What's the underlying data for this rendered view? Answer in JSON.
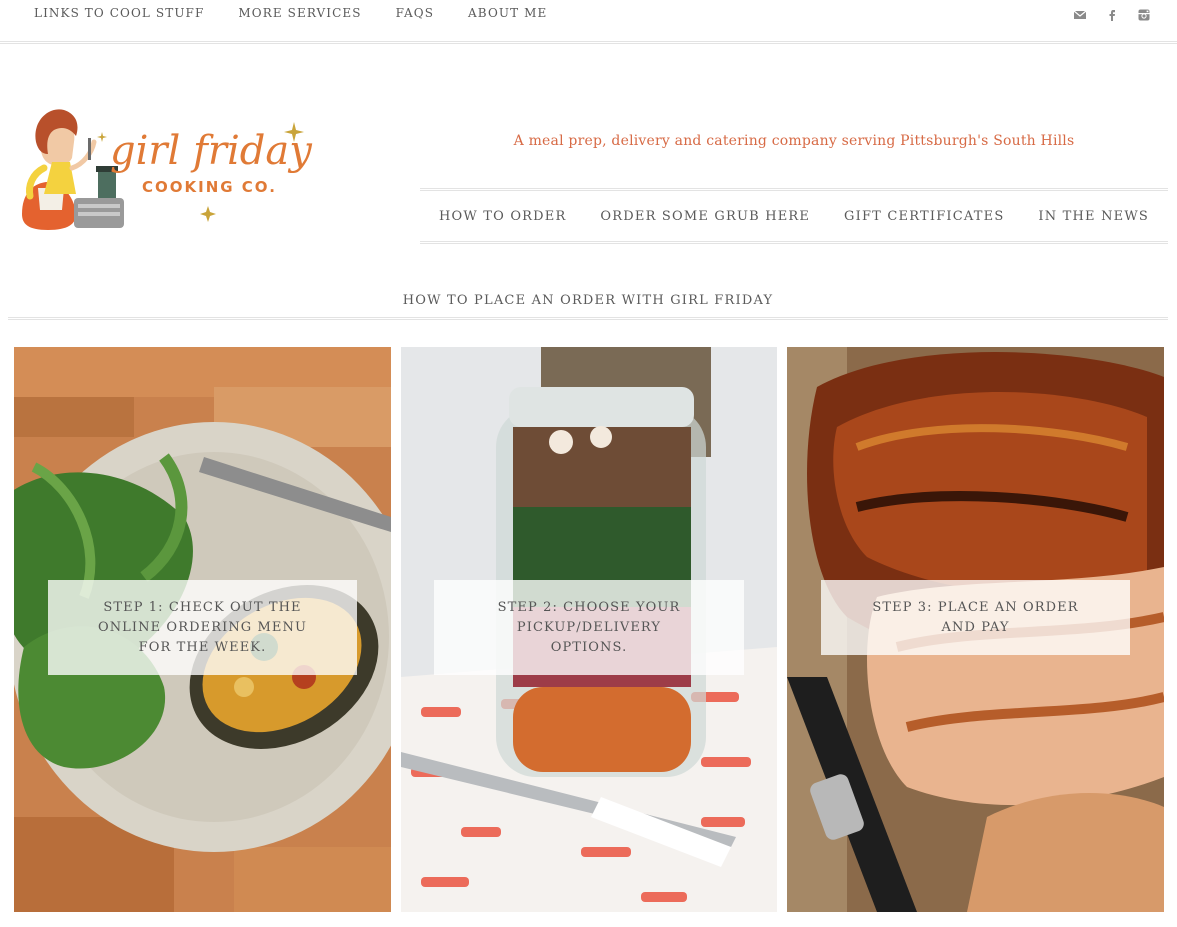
{
  "top_nav": {
    "items": [
      "LINKS TO COOL STUFF",
      "MORE SERVICES",
      "FAQS",
      "ABOUT ME"
    ]
  },
  "social": {
    "icons": [
      "mail-icon",
      "facebook-icon",
      "instagram-icon"
    ],
    "color": "#8a8a8a"
  },
  "logo": {
    "line1": "girl friday",
    "line2": "COOKING CO."
  },
  "tagline": "A meal prep, delivery and catering company serving Pittsburgh's South Hills",
  "main_nav": {
    "items": [
      "HOW TO ORDER",
      "ORDER SOME GRUB HERE",
      "GIFT CERTIFICATES",
      "IN THE NEWS"
    ]
  },
  "section_title": "HOW TO PLACE AN ORDER WITH GIRL FRIDAY",
  "steps": [
    {
      "lines": [
        "STEP 1: CHECK OUT THE",
        "ONLINE ORDERING MENU",
        "FOR THE WEEK."
      ]
    },
    {
      "lines": [
        "STEP 2: CHOOSE YOUR",
        "PICKUP/DELIVERY",
        "OPTIONS."
      ]
    },
    {
      "lines": [
        "STEP 3: PLACE AN ORDER",
        "AND PAY"
      ]
    }
  ],
  "colors": {
    "accent": "#d76a45",
    "nav_text": "#5a5a5a",
    "rule": "#e3e3e3"
  }
}
